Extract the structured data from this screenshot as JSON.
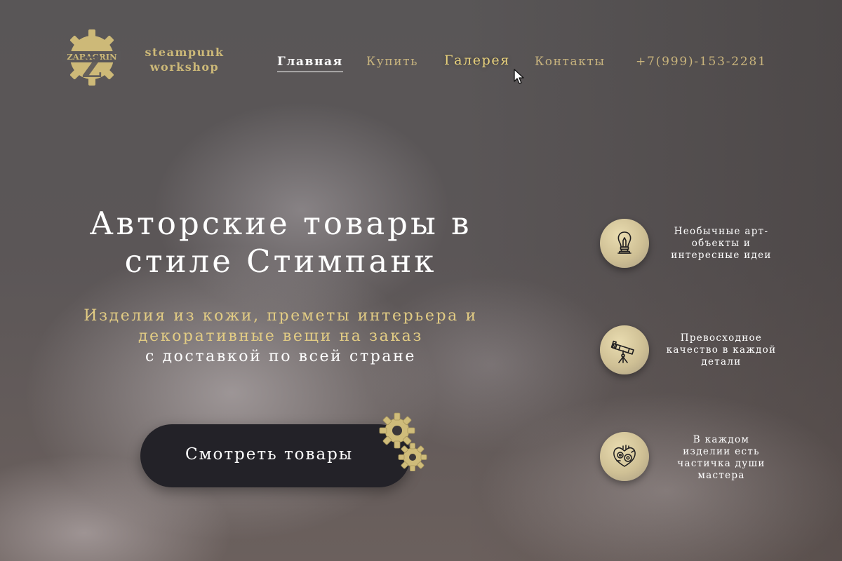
{
  "brand": {
    "logo_letter": "Z",
    "logo_name": "ZABAGRIN",
    "line1": "steampunk",
    "line2": "workshop"
  },
  "nav": {
    "items": [
      {
        "label": "Главная",
        "state": "active"
      },
      {
        "label": "Купить",
        "state": "normal"
      },
      {
        "label": "Галерея",
        "state": "hover"
      },
      {
        "label": "Контакты",
        "state": "normal"
      }
    ],
    "phone": "+7(999)-153-2281"
  },
  "hero": {
    "title_line1": "Авторские товары в",
    "title_line2": "стиле Стимпанк",
    "subtitle_line1": "Изделия из кожи, преметы интерьера и",
    "subtitle_line2": "декоративные вещи на заказ",
    "subtitle_line3": "с доставкой по всей стране",
    "cta_label": "Смотреть товары"
  },
  "features": [
    {
      "icon": "lightbulb-icon",
      "line1": "Необычные арт-",
      "line2": "объекты и",
      "line3": "интересные идеи"
    },
    {
      "icon": "telescope-icon",
      "line1": "Превосходное",
      "line2": "качество в каждой",
      "line3": "детали"
    },
    {
      "icon": "mechanical-heart-icon",
      "line1": "В каждом",
      "line2": "изделии есть",
      "line3": "частичка души",
      "line4": "мастера"
    }
  ],
  "colors": {
    "gold": "#cdb978",
    "gold_bright": "#e2cc84",
    "button_bg": "#232228",
    "text_white": "#ffffff"
  }
}
